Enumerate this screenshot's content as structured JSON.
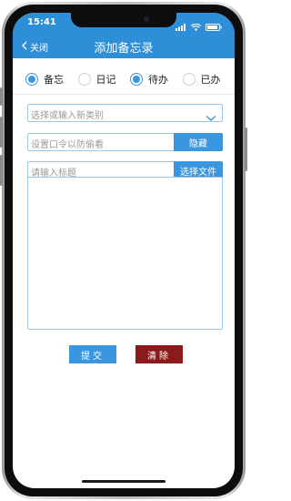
{
  "status": {
    "time": "15:41",
    "icons": [
      "location-arrow-icon",
      "signal-bars-icon",
      "wifi-icon",
      "battery-icon"
    ]
  },
  "nav": {
    "back_label": "关闭",
    "title": "添加备忘录"
  },
  "radios": [
    {
      "label": "备忘",
      "selected": true
    },
    {
      "label": "日记",
      "selected": false
    },
    {
      "label": "待办",
      "selected": true
    },
    {
      "label": "已办",
      "selected": false
    }
  ],
  "category": {
    "placeholder": "选择或输入新类别"
  },
  "password": {
    "placeholder": "设置口令以防偷看",
    "button_label": "隐藏"
  },
  "title_field": {
    "placeholder": "请输入标题",
    "button_label": "选择文件"
  },
  "actions": {
    "submit_label": "提交",
    "clear_label": "清除"
  },
  "colors": {
    "accent": "#3b96e0",
    "header": "#2e8fd8",
    "danger": "#8b1a1a",
    "field_border": "#9cc8ee"
  }
}
